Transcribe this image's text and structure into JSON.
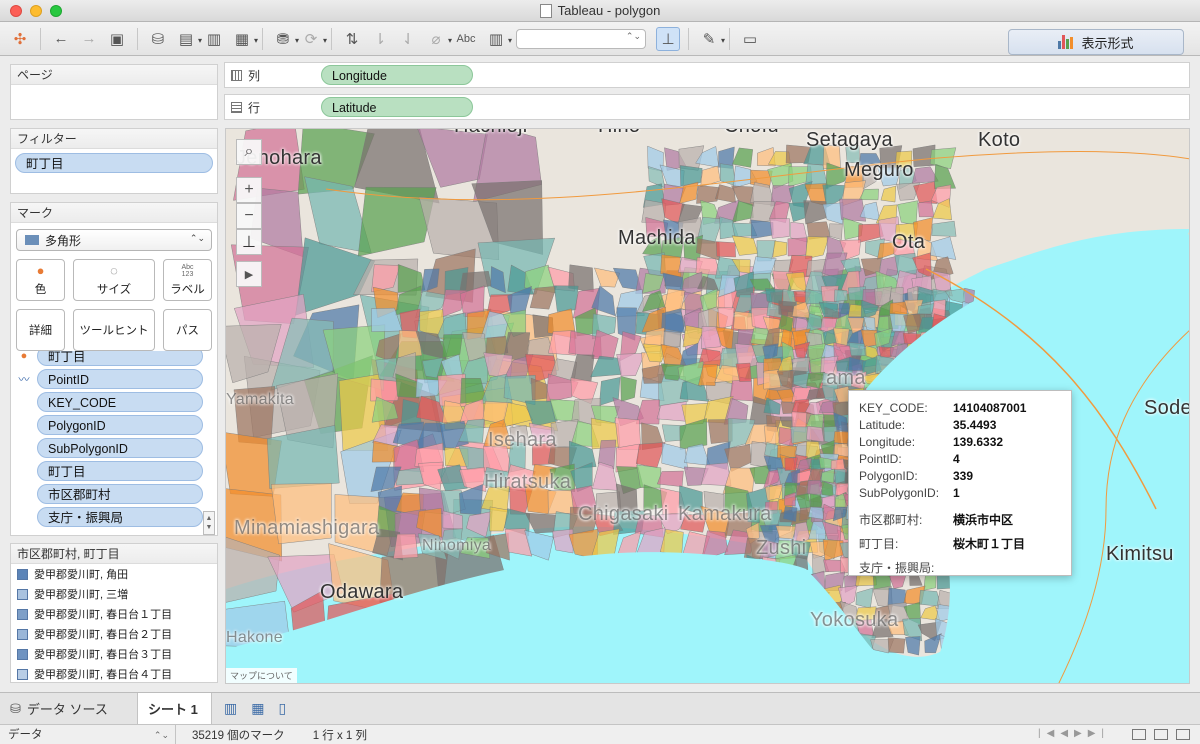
{
  "window": {
    "title": "Tableau - polygon"
  },
  "toolbar": {
    "text_tool_label": "Abc",
    "show_me_label": "表示形式",
    "show_me_bar_colors": [
      "#4e79a7",
      "#e15759",
      "#59a14f",
      "#f28e2b"
    ],
    "icons": [
      "tableau-logo-icon",
      "back-icon",
      "forward-icon",
      "save-icon",
      "new-datasource-icon",
      "new-worksheet-icon",
      "duplicate-sheet-icon",
      "clear-sheet-icon",
      "pause-update-icon",
      "refresh-icon",
      "swap-icon",
      "sort-ascending-icon",
      "sort-descending-icon",
      "group-icon",
      "label-icon",
      "totals-icon",
      "fit-select",
      "pin-icon",
      "highlight-icon",
      "presentation-icon"
    ]
  },
  "panels": {
    "pages_title": "ページ",
    "filters_title": "フィルター",
    "filters": [
      "町丁目"
    ],
    "marks_title": "マーク",
    "mark_type": "多角形",
    "mark_buttons": {
      "color": "色",
      "size": "サイズ",
      "label": "ラベル",
      "label_icon_text": "Abc\n123",
      "detail": "詳細",
      "tooltip": "ツールヒント",
      "path": "パス"
    },
    "mark_fields": [
      "町丁目",
      "PointID",
      "KEY_CODE",
      "PolygonID",
      "SubPolygonID",
      "町丁目",
      "市区郡町村",
      "支庁・振興局"
    ],
    "legend_title": "市区郡町村, 町丁目",
    "legend_items": [
      {
        "label": "愛甲郡愛川町, 角田",
        "color": "#5b84b8"
      },
      {
        "label": "愛甲郡愛川町, 三増",
        "color": "#a9c2df"
      },
      {
        "label": "愛甲郡愛川町, 春日台１丁目",
        "color": "#7e9fc8"
      },
      {
        "label": "愛甲郡愛川町, 春日台２丁目",
        "color": "#9ab6d8"
      },
      {
        "label": "愛甲郡愛川町, 春日台３丁目",
        "color": "#6f93c1"
      },
      {
        "label": "愛甲郡愛川町, 春日台４丁目",
        "color": "#b8cde6"
      }
    ]
  },
  "shelves": {
    "columns_label": "列",
    "columns_pill": "Longitude",
    "rows_label": "行",
    "rows_pill": "Latitude"
  },
  "map": {
    "place_labels": [
      "Hachioji",
      "Hino",
      "Chofu",
      "Setagaya",
      "Koto",
      "Jenohara",
      "Meguro",
      "Machida",
      "Ota",
      "Yamakita",
      "Isehara",
      "Hiratsuka",
      "Chigasaki",
      "Kamakura",
      "Minamiashigara",
      "Ninomiya",
      "Zushi",
      "Odawara",
      "Yokosuka",
      "Hakone",
      "Kimitsu",
      "Sode",
      "ama"
    ],
    "about_label": "マップについて",
    "sea_color": "#9ff5fb"
  },
  "tooltip": {
    "rows": [
      {
        "key": "KEY_CODE:",
        "value": "14104087001"
      },
      {
        "key": "Latitude:",
        "value": "35.4493"
      },
      {
        "key": "Longitude:",
        "value": "139.6332"
      },
      {
        "key": "PointID:",
        "value": "4"
      },
      {
        "key": "PolygonID:",
        "value": "339"
      },
      {
        "key": "SubPolygonID:",
        "value": "1"
      }
    ],
    "city_key": "市区郡町村:",
    "city_value": "横浜市中区",
    "town_key": "町丁目:",
    "town_value": "桜木町１丁目",
    "bureau_key": "支庁・振興局:",
    "bureau_value": ""
  },
  "tabs": {
    "datasource_label": "データ ソース",
    "sheet_label": "シート 1"
  },
  "status": {
    "data_select": "データ",
    "marks_count": "35219 個のマーク",
    "grid_info": "1 行 x 1 列"
  }
}
